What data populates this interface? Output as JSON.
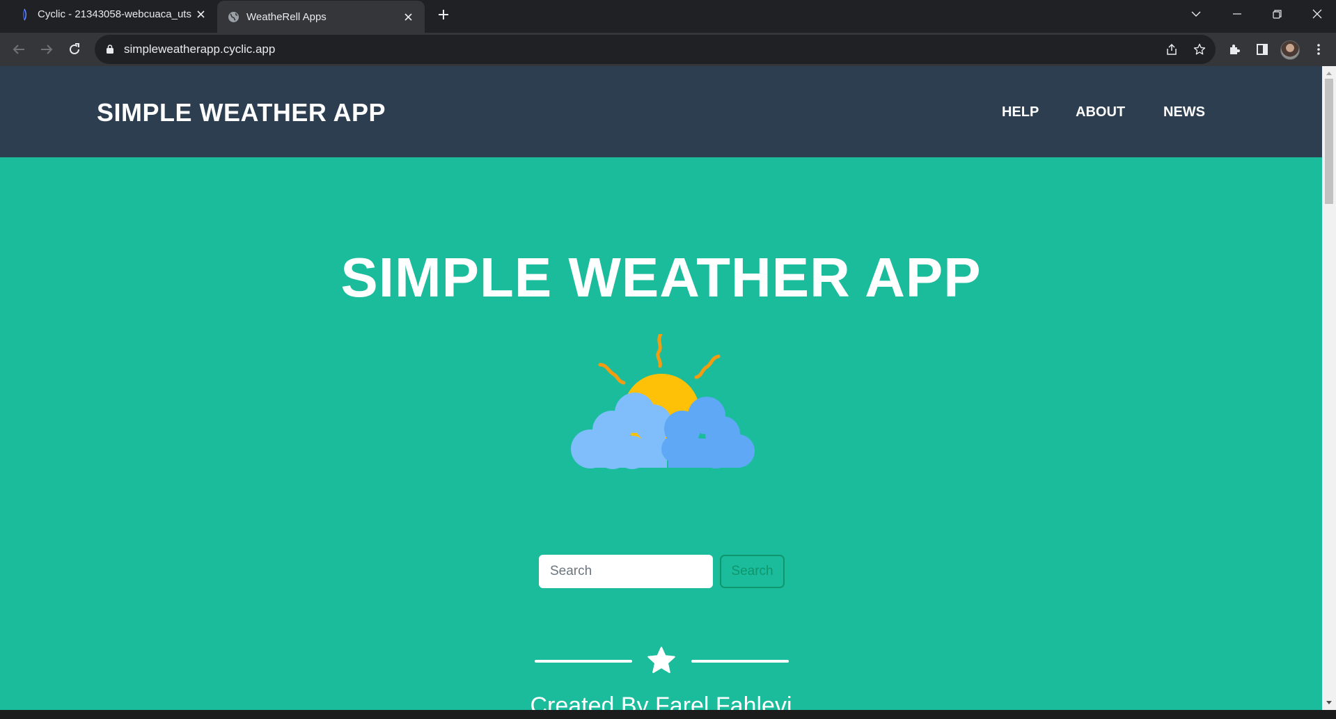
{
  "browser": {
    "tabs": [
      {
        "title": "Cyclic - 21343058-webcuaca_uts",
        "icon": "cyclic-logo-icon",
        "active": false
      },
      {
        "title": "WeatheRell Apps",
        "icon": "globe-icon",
        "active": true
      }
    ],
    "url": "simpleweatherapp.cyclic.app"
  },
  "navbar": {
    "brand": "SIMPLE WEATHER APP",
    "links": [
      "HELP",
      "ABOUT",
      "NEWS"
    ]
  },
  "masthead": {
    "title": "SIMPLE WEATHER APP",
    "image": "sun-behind-clouds-icon"
  },
  "search": {
    "placeholder": "Search",
    "button_label": "Search"
  },
  "footer": {
    "credit": "Created By Farel Fahlevi"
  },
  "colors": {
    "primary_bg": "#1abc9c",
    "navbar_bg": "#2c3e50",
    "search_button": "#10966c",
    "sun": "#ffc107",
    "sun_rays": "#f39c12",
    "cloud_light": "#7fbdfb",
    "cloud_dark": "#5ea8f6"
  }
}
